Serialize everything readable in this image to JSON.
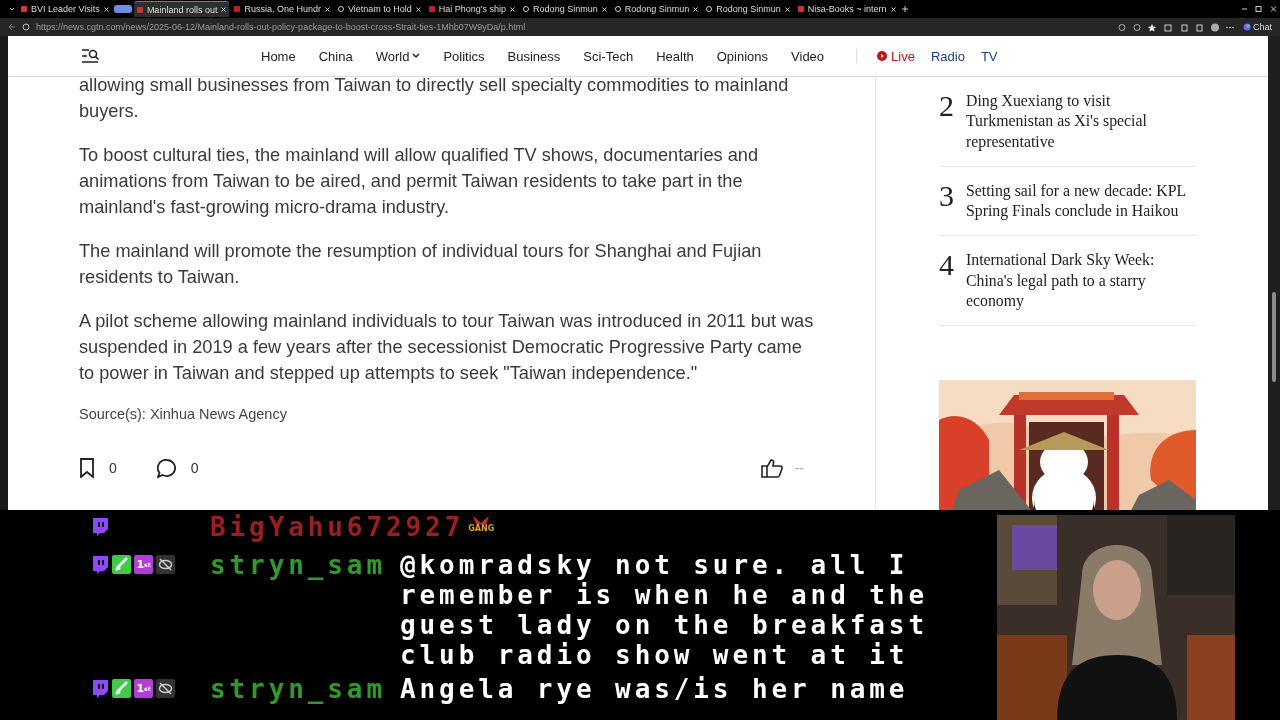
{
  "browser": {
    "tabs": [
      {
        "title": "BVI Leader Visits",
        "selected": false,
        "kind": "video"
      },
      {
        "title": "Mainland rolls out",
        "selected": true,
        "kind": "doc"
      },
      {
        "title": "Russia, One Hundr",
        "selected": false,
        "kind": "news"
      },
      {
        "title": "Vietnam to Hold",
        "selected": false,
        "kind": "globe"
      },
      {
        "title": "Hai Phong's ship",
        "selected": false,
        "kind": "news"
      },
      {
        "title": "Rodong Sinmun",
        "selected": false,
        "kind": "globe"
      },
      {
        "title": "Rodong Sinmun",
        "selected": false,
        "kind": "globe"
      },
      {
        "title": "Rodong Sinmun",
        "selected": false,
        "kind": "globe"
      },
      {
        "title": "Nisa-Books ~ intern",
        "selected": false,
        "kind": "doc"
      }
    ],
    "url": "https://news.cgtn.com/news/2025-06-12/Mainland-rolls-out-policy-package-to-boost-cross-Strait-ties-1Mhb07W9yDa/p.html",
    "chat_label": "Chat"
  },
  "nav": {
    "items": [
      {
        "label": "Home",
        "dropdown": false
      },
      {
        "label": "China",
        "dropdown": false
      },
      {
        "label": "World",
        "dropdown": true
      },
      {
        "label": "Politics",
        "dropdown": false
      },
      {
        "label": "Business",
        "dropdown": false
      },
      {
        "label": "Sci-Tech",
        "dropdown": false
      },
      {
        "label": "Health",
        "dropdown": false
      },
      {
        "label": "Opinions",
        "dropdown": false
      },
      {
        "label": "Video",
        "dropdown": false
      }
    ],
    "live": "Live",
    "radio": "Radio",
    "tv": "TV"
  },
  "article": {
    "paragraphs": [
      "allowing small businesses from Taiwan to directly sell specialty commodities to mainland buyers.",
      "To boost cultural ties, the mainland will allow qualified TV shows, documentaries and animations from Taiwan to be aired, and permit Taiwan residents to take part in the mainland's fast-growing micro-drama industry.",
      "The mainland will promote the resumption of individual tours for Shanghai and Fujian residents to Taiwan.",
      "A pilot scheme allowing mainland individuals to tour Taiwan was introduced in 2011 but was suspended in 2019 a few years after the secessionist Democratic Progressive Party came to power in Taiwan and stepped up attempts to seek \"Taiwan independence.\""
    ],
    "source": "Source(s): Xinhua News Agency",
    "bookmarks": "0",
    "comments": "0",
    "likes": "--"
  },
  "most_read": [
    {
      "rank": "2",
      "title": "Ding Xuexiang to visit Turkmenistan as Xi's special representative"
    },
    {
      "rank": "3",
      "title": "Setting sail for a new decade: KPL Spring Finals conclude in Haikou"
    },
    {
      "rank": "4",
      "title": "International Dark Sky Week: China's legal path to a starry economy"
    }
  ],
  "chat": [
    {
      "user": "BigYahu672927",
      "color": "#9c1f1f",
      "badges": [
        {
          "kind": "platform"
        }
      ],
      "emote": "GANG"
    },
    {
      "user": "stryn_sam",
      "color": "#2f9a2a",
      "badges": [
        {
          "kind": "platform"
        },
        {
          "kind": "sword"
        },
        {
          "kind": "first",
          "label": "1$^{st}$"
        },
        {
          "kind": "hidden"
        }
      ],
      "text": "@komradsky not sure. all I remember is when he and the guest lady on the breakfast club radio show went at it"
    },
    {
      "user": "stryn_sam",
      "color": "#2f9a2a",
      "badges": [
        {
          "kind": "platform"
        },
        {
          "kind": "sword"
        },
        {
          "kind": "first",
          "label": "1$^{st}$"
        },
        {
          "kind": "hidden"
        }
      ],
      "text": "Angela rye was/is her name"
    }
  ]
}
